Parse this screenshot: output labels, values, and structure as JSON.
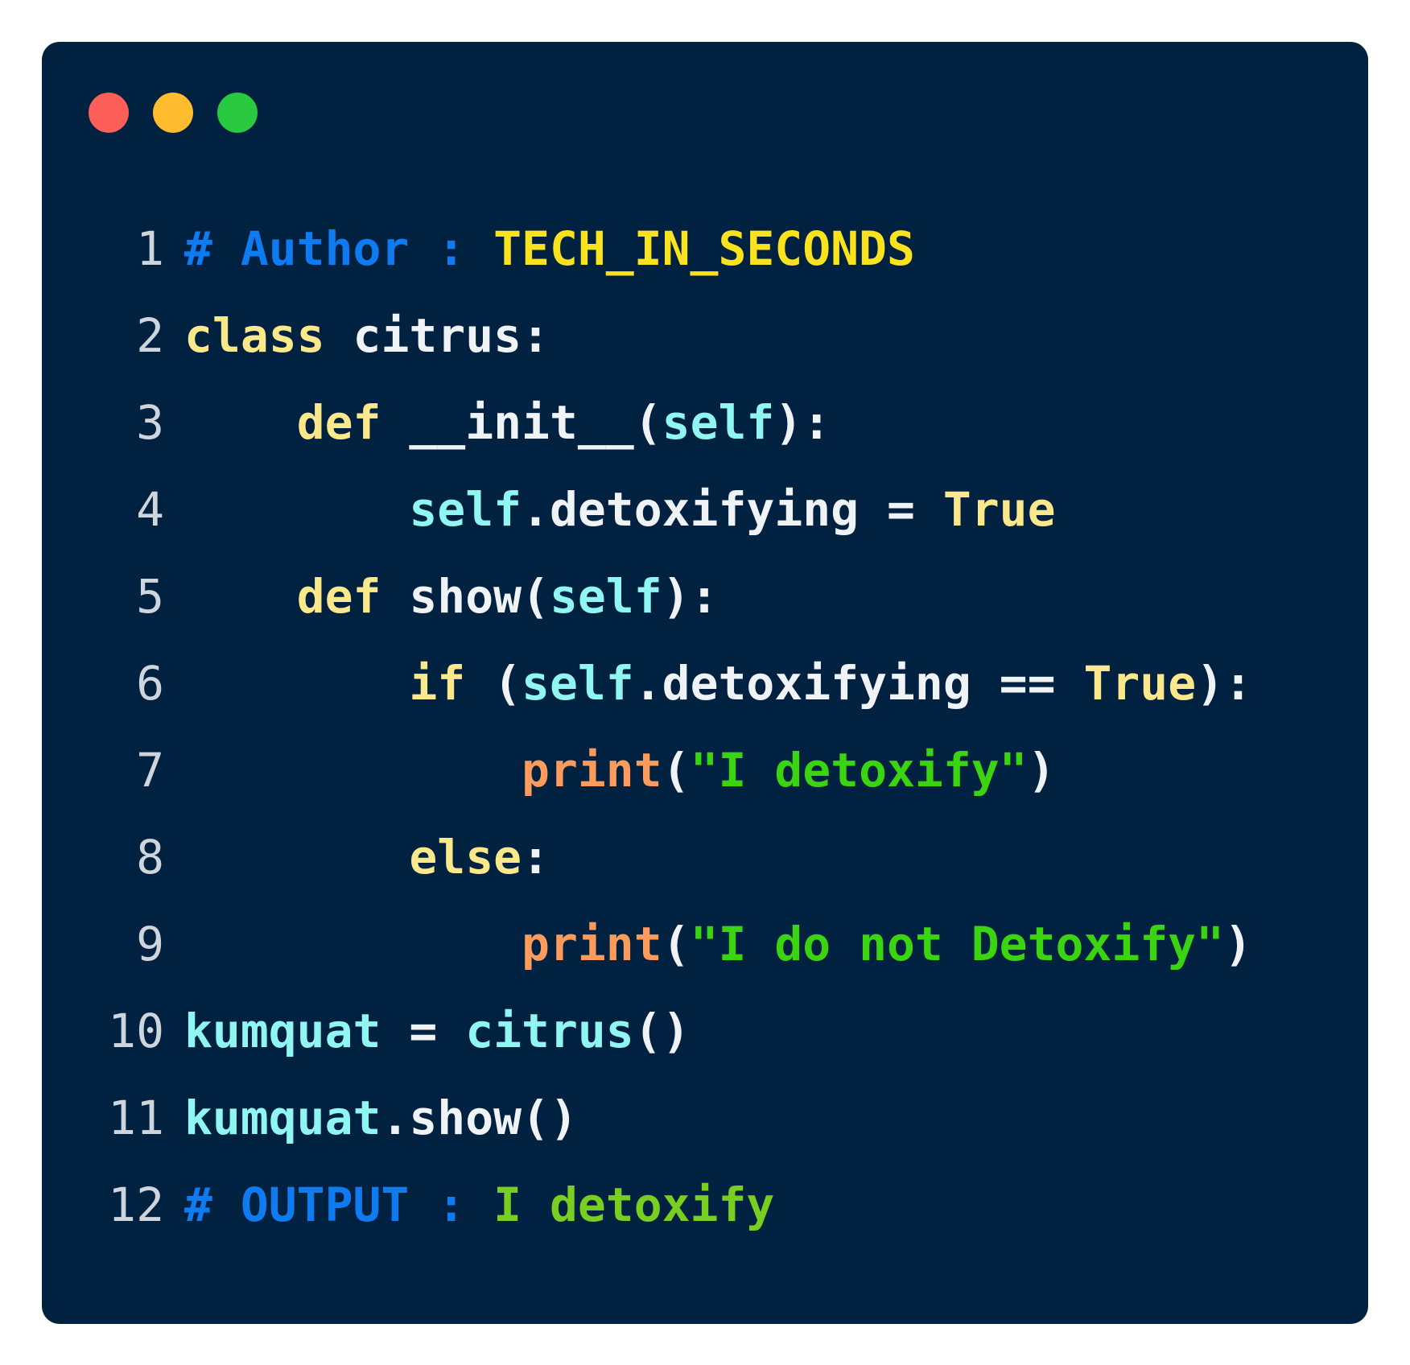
{
  "window": {
    "controls": [
      "close",
      "minimize",
      "maximize"
    ],
    "colors": {
      "background": "#012141",
      "close": "#fe5f58",
      "minimize": "#febc2e",
      "maximize": "#29c940"
    }
  },
  "code": {
    "language": "python",
    "lines": [
      {
        "num": "1",
        "tokens": [
          {
            "t": "# Author : ",
            "c": "comment"
          },
          {
            "t": "TECH_IN_SECONDS",
            "c": "author"
          }
        ]
      },
      {
        "num": "2",
        "tokens": [
          {
            "t": "class",
            "c": "kw"
          },
          {
            "t": " citrus:",
            "c": "id"
          }
        ]
      },
      {
        "num": "3",
        "tokens": [
          {
            "t": "    ",
            "c": "id"
          },
          {
            "t": "def",
            "c": "kw"
          },
          {
            "t": " __init__(",
            "c": "id"
          },
          {
            "t": "self",
            "c": "self"
          },
          {
            "t": "):",
            "c": "id"
          }
        ]
      },
      {
        "num": "4",
        "tokens": [
          {
            "t": "        ",
            "c": "id"
          },
          {
            "t": "self",
            "c": "self"
          },
          {
            "t": ".detoxifying = ",
            "c": "id"
          },
          {
            "t": "True",
            "c": "kw"
          }
        ]
      },
      {
        "num": "5",
        "tokens": [
          {
            "t": "    ",
            "c": "id"
          },
          {
            "t": "def",
            "c": "kw"
          },
          {
            "t": " show(",
            "c": "id"
          },
          {
            "t": "self",
            "c": "self"
          },
          {
            "t": "):",
            "c": "id"
          }
        ]
      },
      {
        "num": "6",
        "tokens": [
          {
            "t": "        ",
            "c": "id"
          },
          {
            "t": "if",
            "c": "kw"
          },
          {
            "t": " (",
            "c": "id"
          },
          {
            "t": "self",
            "c": "self"
          },
          {
            "t": ".detoxifying == ",
            "c": "id"
          },
          {
            "t": "True",
            "c": "kw"
          },
          {
            "t": "):",
            "c": "id"
          }
        ]
      },
      {
        "num": "7",
        "tokens": [
          {
            "t": "            ",
            "c": "id"
          },
          {
            "t": "print",
            "c": "fn"
          },
          {
            "t": "(",
            "c": "id"
          },
          {
            "t": "\"I detoxify\"",
            "c": "str"
          },
          {
            "t": ")",
            "c": "id"
          }
        ]
      },
      {
        "num": "8",
        "tokens": [
          {
            "t": "        ",
            "c": "id"
          },
          {
            "t": "else",
            "c": "kw"
          },
          {
            "t": ":",
            "c": "id"
          }
        ]
      },
      {
        "num": "9",
        "tokens": [
          {
            "t": "            ",
            "c": "id"
          },
          {
            "t": "print",
            "c": "fn"
          },
          {
            "t": "(",
            "c": "id"
          },
          {
            "t": "\"I do not Detoxify\"",
            "c": "str"
          },
          {
            "t": ")",
            "c": "id"
          }
        ]
      },
      {
        "num": "10",
        "tokens": [
          {
            "t": "kumquat",
            "c": "self"
          },
          {
            "t": " = ",
            "c": "id"
          },
          {
            "t": "citrus",
            "c": "self"
          },
          {
            "t": "()",
            "c": "id"
          }
        ]
      },
      {
        "num": "11",
        "tokens": [
          {
            "t": "kumquat",
            "c": "self"
          },
          {
            "t": ".show()",
            "c": "id"
          }
        ]
      },
      {
        "num": "12",
        "tokens": [
          {
            "t": "# OUTPUT : ",
            "c": "comment"
          },
          {
            "t": "I detoxify",
            "c": "out"
          }
        ]
      }
    ]
  }
}
